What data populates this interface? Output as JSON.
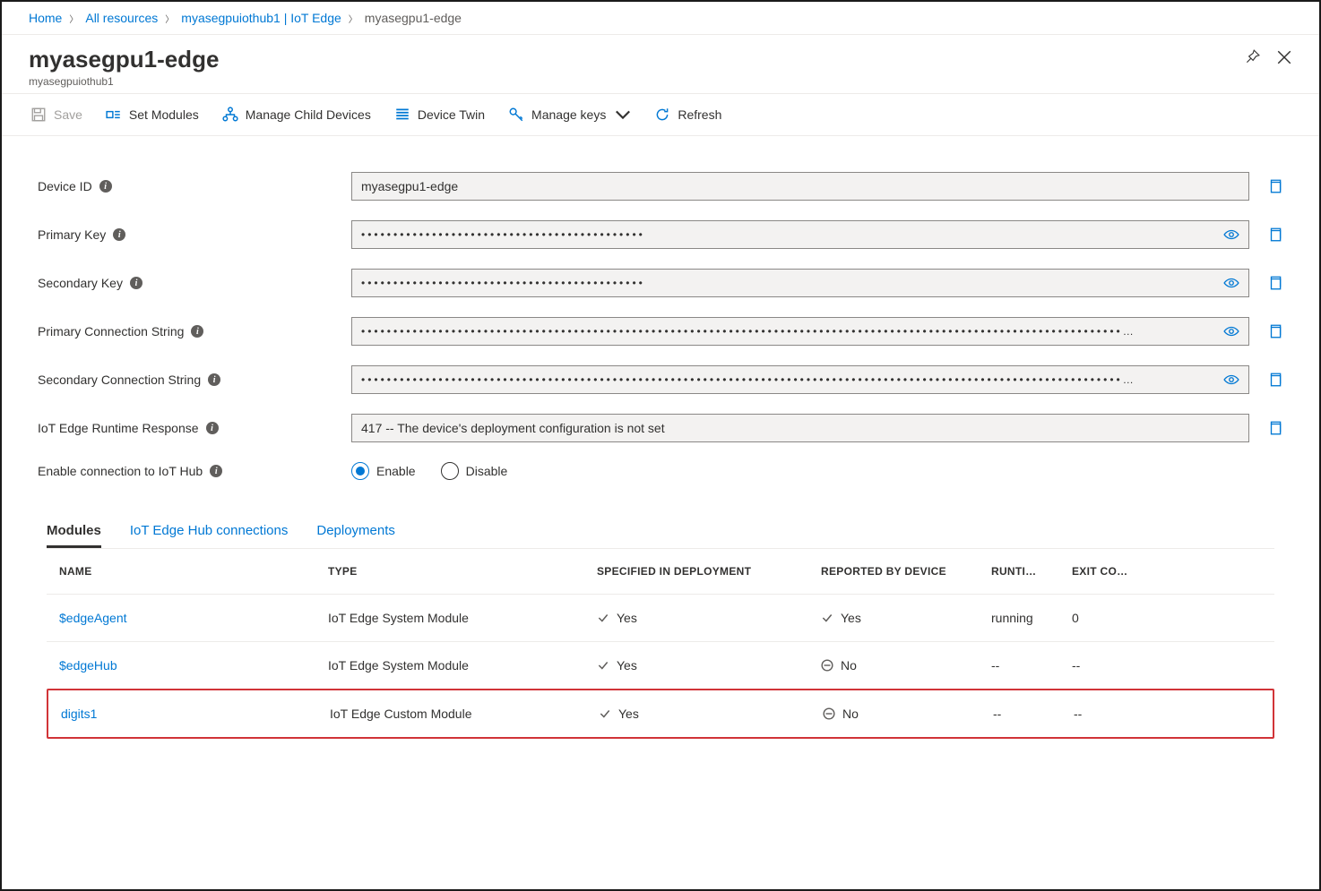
{
  "breadcrumb": {
    "items": [
      "Home",
      "All resources",
      "myasegpuiothub1 | IoT Edge"
    ],
    "current": "myasegpu1-edge"
  },
  "header": {
    "title": "myasegpu1-edge",
    "subtitle": "myasegpuiothub1"
  },
  "toolbar": {
    "save": "Save",
    "set_modules": "Set Modules",
    "manage_child": "Manage Child Devices",
    "device_twin": "Device Twin",
    "manage_keys": "Manage keys",
    "refresh": "Refresh"
  },
  "form": {
    "device_id": {
      "label": "Device ID",
      "value": "myasegpu1-edge"
    },
    "primary_key": {
      "label": "Primary Key",
      "value": "••••••••••••••••••••••••••••••••••••••••••••"
    },
    "secondary_key": {
      "label": "Secondary Key",
      "value": "••••••••••••••••••••••••••••••••••••••••••••"
    },
    "primary_conn": {
      "label": "Primary Connection String",
      "value": "••••••••••••••••••••••••••••••••••••••••••••••••••••••••••••••••••••••••••••••••••••••••••••••••••••••••••••••••••••••…"
    },
    "secondary_conn": {
      "label": "Secondary Connection String",
      "value": "••••••••••••••••••••••••••••••••••••••••••••••••••••••••••••••••••••••••••••••••••••••••••••••••••••••••••••••••••••••…"
    },
    "runtime_response": {
      "label": "IoT Edge Runtime Response",
      "value": "417 -- The device's deployment configuration is not set"
    },
    "enable_conn": {
      "label": "Enable connection to IoT Hub",
      "enable": "Enable",
      "disable": "Disable"
    }
  },
  "tabs": {
    "modules": "Modules",
    "connections": "IoT Edge Hub connections",
    "deployments": "Deployments"
  },
  "table": {
    "headers": {
      "name": "NAME",
      "type": "TYPE",
      "specified": "SPECIFIED IN DEPLOYMENT",
      "reported": "REPORTED BY DEVICE",
      "runtime": "RUNTI…",
      "exit": "EXIT CO…"
    },
    "rows": [
      {
        "name": "$edgeAgent",
        "type": "IoT Edge System Module",
        "specified": "Yes",
        "reported": "Yes",
        "reported_ok": true,
        "runtime": "running",
        "exit": "0"
      },
      {
        "name": "$edgeHub",
        "type": "IoT Edge System Module",
        "specified": "Yes",
        "reported": "No",
        "reported_ok": false,
        "runtime": "--",
        "exit": "--"
      },
      {
        "name": "digits1",
        "type": "IoT Edge Custom Module",
        "specified": "Yes",
        "reported": "No",
        "reported_ok": false,
        "runtime": "--",
        "exit": "--"
      }
    ]
  }
}
